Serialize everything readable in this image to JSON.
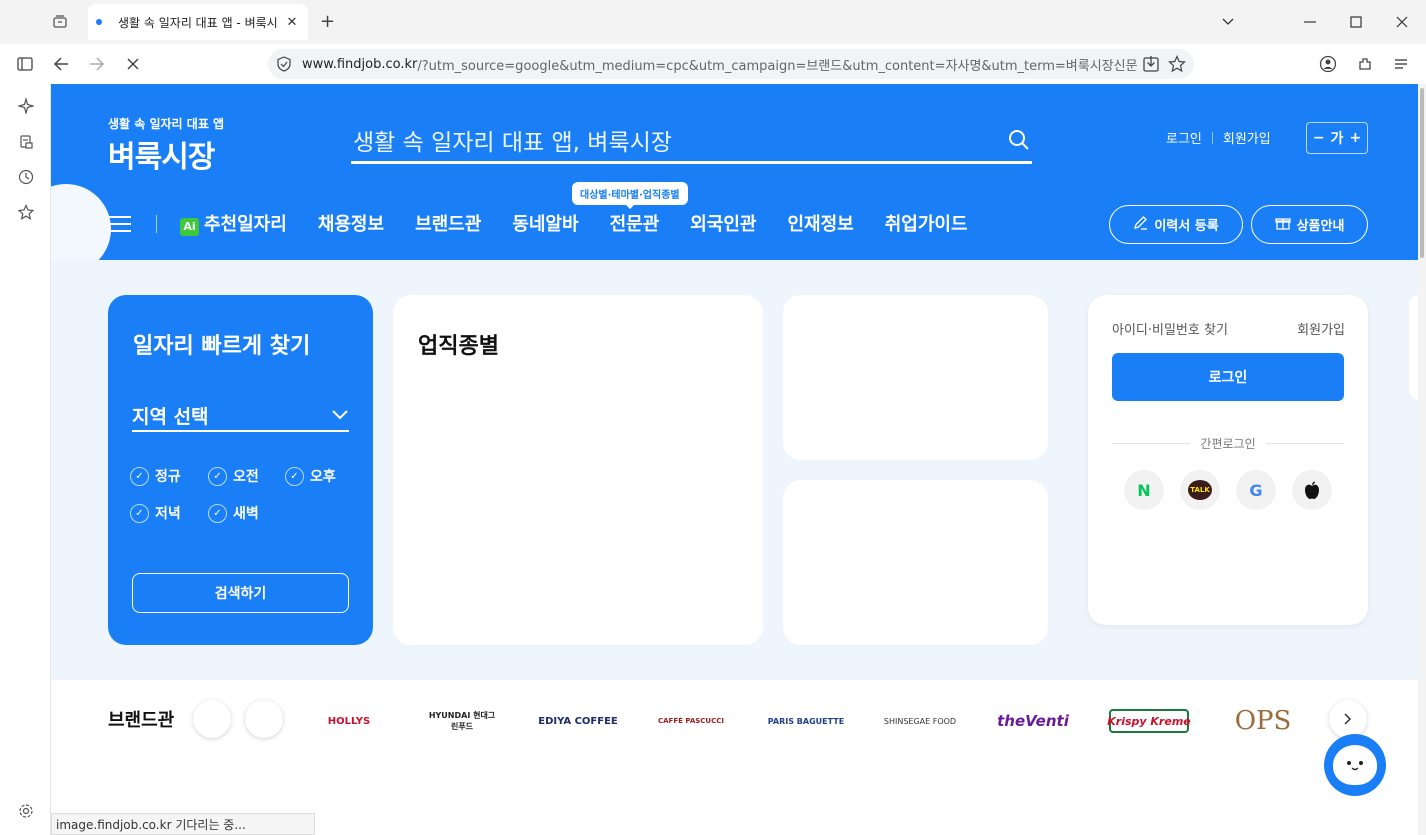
{
  "browser": {
    "tab_title": "생활 속 일자리 대표 앱 - 벼룩시",
    "url_domain": "www.findjob.co.kr",
    "url_path": "/?utm_source=google&utm_medium=cpc&utm_campaign=브랜드&utm_content=자사명&utm_term=벼룩시장신문",
    "status_text": "image.findjob.co.kr 기다리는 중..."
  },
  "header": {
    "logo_sub": "생활 속 일자리 대표 앱",
    "logo": "벼룩시장",
    "search_placeholder": "생활 속 일자리 대표 앱, 벼룩시장",
    "login": "로그인",
    "signup": "회원가입",
    "font_control": {
      "minus": "−",
      "label": "가",
      "plus": "+"
    },
    "tooltip": "대상별·테마별·업직종별",
    "nav": [
      "추천일자리",
      "채용정보",
      "브랜드관",
      "동네알바",
      "전문관",
      "외국인관",
      "인재정보",
      "취업가이드"
    ],
    "ai_badge": "Ai",
    "resume_button": "이력서 등록",
    "product_button": "상품안내"
  },
  "quick_search": {
    "title": "일자리 빠르게 찾기",
    "region": "지역 선택",
    "options": [
      "정규",
      "오전",
      "오후",
      "저녁",
      "새벽"
    ],
    "search_button": "검색하기"
  },
  "job_category": {
    "title": "업직종별"
  },
  "login_box": {
    "find": "아이디·비밀번호 찾기",
    "signup": "회원가입",
    "login_button": "로그인",
    "easy_login": "간편로그인",
    "social": [
      "N",
      "TALK",
      "G",
      ""
    ]
  },
  "brands": {
    "label": "브랜드관",
    "items": [
      "HOLLYS",
      "HYUNDAI 현대그린푸드",
      "EDIYA COFFEE",
      "CAFFÈ PASCUCCI",
      "PARIS BAGUETTE",
      "SHINSEGAE FOOD",
      "theVenti",
      "Krispy Kreme",
      "OPS"
    ]
  },
  "colors": {
    "brand_blue": "#1a7ff7",
    "bg_light": "#eef5fd"
  }
}
